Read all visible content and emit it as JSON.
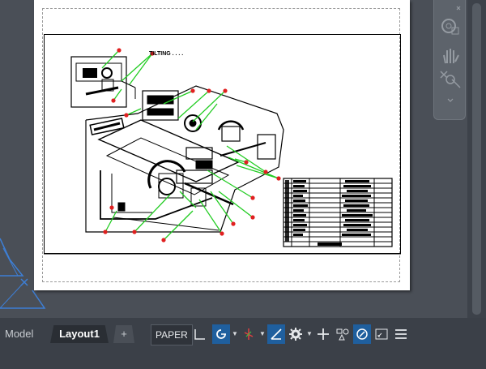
{
  "layout_tabs": {
    "model_label": "Model",
    "active_label": "Layout1",
    "add_label": "+"
  },
  "drawing": {
    "title_text": "TILTING . . . ."
  },
  "statusbar": {
    "space_label": "PAPER",
    "icons": [
      "grid-icon",
      "snap-mode-icon",
      "ortho-icon",
      "polar-tracking-icon",
      "isodraft-icon",
      "object-snap-tracking-icon",
      "osnap-icon",
      "annotation-scale-icon",
      "workspace-gear-icon",
      "add-icon",
      "units-icon",
      "quick-properties-icon",
      "isolate-objects-icon",
      "fullscreen-icon",
      "customize-menu-icon"
    ],
    "accent_color": "#1f5f9e"
  }
}
